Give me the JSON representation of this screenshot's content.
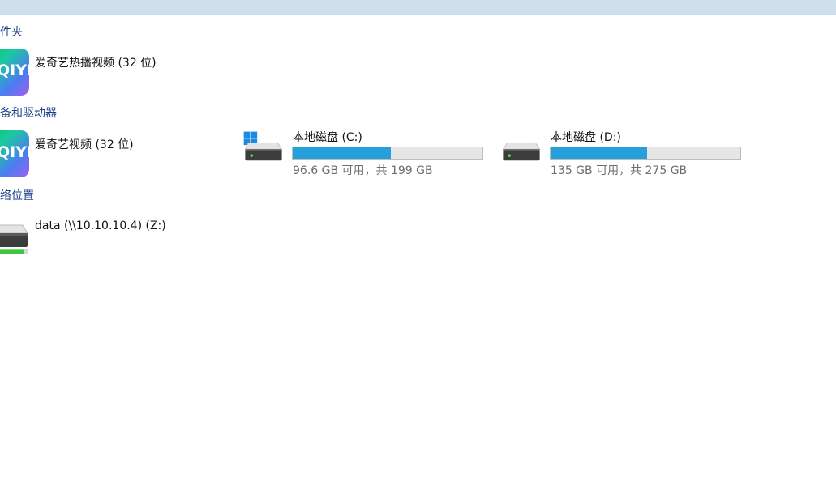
{
  "sections": {
    "folders": {
      "header": "件夹"
    },
    "devices": {
      "header": "备和驱动器"
    },
    "network": {
      "header": "络位置"
    }
  },
  "folders": {
    "items": [
      {
        "label": "爱奇艺热播视频 (32 位)",
        "icon": "iqiyi-app-icon",
        "logo_text": "QIYI"
      }
    ]
  },
  "devices": {
    "apps": [
      {
        "label": "爱奇艺视频 (32 位)",
        "icon": "iqiyi-app-icon",
        "logo_text": "QIYI"
      }
    ],
    "drives": [
      {
        "label": "本地磁盘 (C:)",
        "free_text": "96.6 GB 可用，共 199 GB",
        "used_fraction": 0.515,
        "icon": "windows-system-drive-icon"
      },
      {
        "label": "本地磁盘 (D:)",
        "free_text": "135 GB 可用，共 275 GB",
        "used_fraction": 0.509,
        "icon": "hard-drive-icon"
      }
    ]
  },
  "network": {
    "items": [
      {
        "label": "data (\\\\10.10.10.4) (Z:)",
        "icon": "network-drive-icon"
      }
    ]
  },
  "colors": {
    "header_text": "#1d3f8a",
    "bar_fill": "#26a0da",
    "bar_bg": "#e6e6e6",
    "top_bar": "#cfe0ec",
    "network_status_green": "#3ec43e"
  }
}
